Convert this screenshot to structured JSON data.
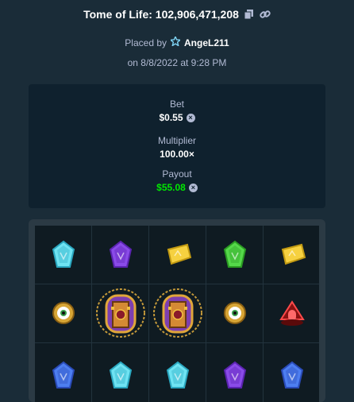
{
  "header": {
    "title": "Tome of Life: 102,906,471,208"
  },
  "meta": {
    "placed_by_label": "Placed by",
    "user": "AngeL211",
    "date": "on 8/8/2022 at 9:28 PM"
  },
  "stats": {
    "bet_label": "Bet",
    "bet_value": "$0.55",
    "multiplier_label": "Multiplier",
    "multiplier_value": "100.00×",
    "payout_label": "Payout",
    "payout_value": "$55.08"
  },
  "colors": {
    "background": "#1a2c38",
    "panel": "#0f212e",
    "payout_green": "#00e701",
    "muted_text": "#b1bad3"
  },
  "reels": [
    [
      "cyan-gem",
      "eye-amulet",
      "blue-gem"
    ],
    [
      "purple-gem",
      "tome-book",
      "cyan-gem"
    ],
    [
      "yellow-gem",
      "tome-book",
      "cyan-gem"
    ],
    [
      "green-gem",
      "eye-amulet",
      "purple-gem"
    ],
    [
      "yellow-gem",
      "red-shrine",
      "blue-gem"
    ]
  ]
}
